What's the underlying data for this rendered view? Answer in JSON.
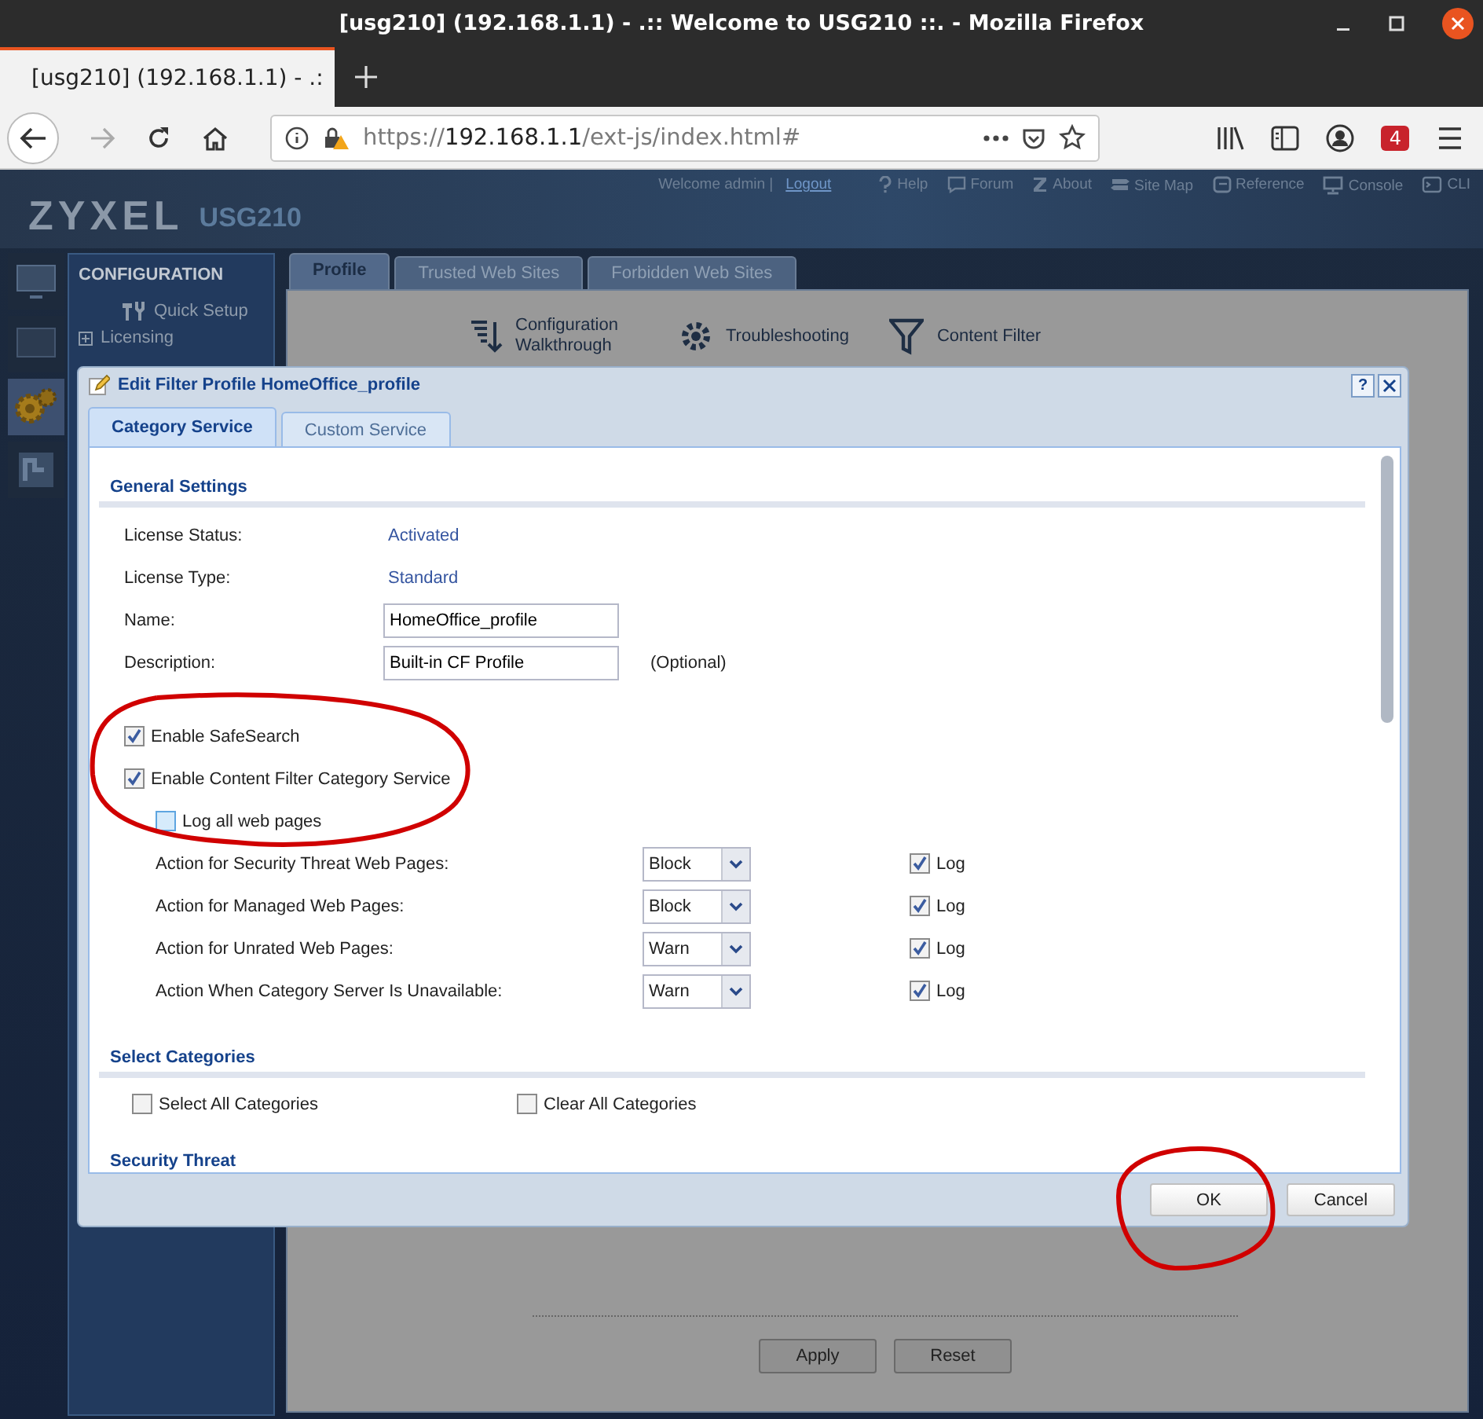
{
  "window": {
    "title": "[usg210] (192.168.1.1) - .:: Welcome to USG210 ::. - Mozilla Firefox"
  },
  "browser_tabs": [
    {
      "title": "[usg210] (192.168.1.1) - .:",
      "selected": true
    }
  ],
  "address_bar": {
    "scheme": "https://",
    "host": "192.168.1.1",
    "path": "/ext-js/index.html#"
  },
  "toolbar_badge": "4",
  "header": {
    "logo": "ZYXEL",
    "model": "USG210",
    "welcome": "Welcome admin |",
    "links": [
      {
        "label": "Logout",
        "kind": "logout"
      },
      {
        "label": "Help",
        "kind": "help"
      },
      {
        "label": "Forum",
        "kind": "forum"
      },
      {
        "label": "About",
        "kind": "about"
      },
      {
        "label": "Site Map",
        "kind": "sitemap"
      },
      {
        "label": "Reference",
        "kind": "reference"
      },
      {
        "label": "Console",
        "kind": "console"
      },
      {
        "label": "CLI",
        "kind": "cli"
      }
    ]
  },
  "nav_rail": [
    {
      "kind": "dashboard",
      "selected": false
    },
    {
      "kind": "monitor",
      "selected": false
    },
    {
      "kind": "configuration",
      "selected": true
    },
    {
      "kind": "maintenance",
      "selected": false
    }
  ],
  "sidebar": {
    "heading": "CONFIGURATION",
    "items": [
      {
        "label": "Quick Setup",
        "kind": "wizard"
      },
      {
        "label": "Licensing",
        "kind": "tree",
        "expanded": false
      }
    ]
  },
  "main_tabs": [
    {
      "label": "Profile",
      "selected": true
    },
    {
      "label": "Trusted Web Sites",
      "selected": false
    },
    {
      "label": "Forbidden Web Sites",
      "selected": false
    }
  ],
  "main_toolbar": [
    {
      "label": "Configuration Walkthrough",
      "kind": "walkthrough"
    },
    {
      "label": "Troubleshooting",
      "kind": "troubleshooting"
    },
    {
      "label": "Content Filter",
      "kind": "filter"
    }
  ],
  "main_buttons": [
    "Apply",
    "Reset"
  ],
  "dialog": {
    "title": "Edit Filter Profile HomeOffice_profile",
    "help": "?",
    "tabs": [
      {
        "label": "Category Service",
        "selected": true
      },
      {
        "label": "Custom Service",
        "selected": false
      }
    ],
    "general_heading": "General Settings",
    "fields": [
      {
        "label": "License Status:",
        "kind": "text",
        "value": "Activated"
      },
      {
        "label": "License Type:",
        "kind": "text",
        "value": "Standard"
      },
      {
        "label": "Name:",
        "kind": "input",
        "value": "HomeOffice_profile"
      },
      {
        "label": "Description:",
        "kind": "input",
        "value": "Built-in CF Profile",
        "note": "(Optional)"
      }
    ],
    "options": [
      {
        "label": "Enable SafeSearch",
        "checked": true,
        "indented": false,
        "focused": false
      },
      {
        "label": "Enable Content Filter Category Service",
        "checked": true,
        "indented": false,
        "focused": false
      },
      {
        "label": "Log all web pages",
        "checked": false,
        "indented": true,
        "focused": true
      }
    ],
    "actions": [
      {
        "label": "Action for Security Threat Web Pages:",
        "value": "Block",
        "log_label": "Log",
        "log": true
      },
      {
        "label": "Action for Managed Web Pages:",
        "value": "Block",
        "log_label": "Log",
        "log": true
      },
      {
        "label": "Action for Unrated Web Pages:",
        "value": "Warn",
        "log_label": "Log",
        "log": true
      },
      {
        "label": "Action When Category Server Is Unavailable:",
        "value": "Warn",
        "log_label": "Log",
        "log": true
      }
    ],
    "categories_heading": "Select Categories",
    "category_options": [
      {
        "label": "Select All Categories",
        "checked": false
      },
      {
        "label": "Clear All Categories",
        "checked": false
      }
    ],
    "next_heading": "Security Threat",
    "buttons": [
      "OK",
      "Cancel"
    ]
  }
}
